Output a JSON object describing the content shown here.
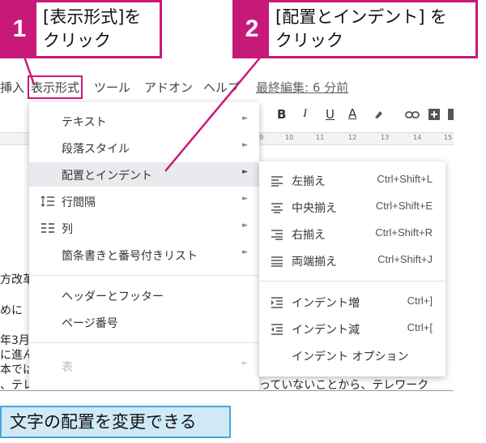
{
  "callouts": [
    {
      "number": "1",
      "text": "[表示形式]を\nクリック"
    },
    {
      "number": "2",
      "text": "[配置とインデント] を\nクリック"
    }
  ],
  "menubar": {
    "insert": "挿入",
    "format": "表示形式",
    "tools": "ツール",
    "addons": "アドオン",
    "help": "ヘルプ",
    "last_edit": "最終編集: 6 分前"
  },
  "toolbar": {
    "bold": "B",
    "italic": "I",
    "underline": "U",
    "text_color": "A"
  },
  "ruler_ticks": [
    "9",
    "10",
    "11",
    "12",
    "13",
    "14",
    "15"
  ],
  "doc_fragments": [
    "方改革",
    "めに",
    "年3月",
    "に進ん",
    "本では",
    "、テレ",
    "っていないことから、テレワーク"
  ],
  "format_menu": {
    "items": [
      {
        "label": "テキスト"
      },
      {
        "label": "段落スタイル"
      },
      {
        "label": "配置とインデント"
      },
      {
        "label": "行間隔"
      },
      {
        "label": "列"
      },
      {
        "label": "箇条書きと番号付きリスト"
      },
      {
        "label": "ヘッダーとフッター"
      },
      {
        "label": "ページ番号"
      },
      {
        "label": "表"
      }
    ]
  },
  "align_submenu": {
    "items": [
      {
        "label": "左揃え",
        "shortcut": "Ctrl+Shift+L"
      },
      {
        "label": "中央揃え",
        "shortcut": "Ctrl+Shift+E"
      },
      {
        "label": "右揃え",
        "shortcut": "Ctrl+Shift+R"
      },
      {
        "label": "両端揃え",
        "shortcut": "Ctrl+Shift+J"
      },
      {
        "label": "インデント増",
        "shortcut": "Ctrl+]"
      },
      {
        "label": "インデント減",
        "shortcut": "Ctrl+["
      },
      {
        "label": "インデント オプション"
      }
    ]
  },
  "caption": "文字の配置を変更できる",
  "colors": {
    "accent": "#c8187a",
    "caption_bg": "#cfe9f7",
    "caption_border": "#49a7d8"
  }
}
